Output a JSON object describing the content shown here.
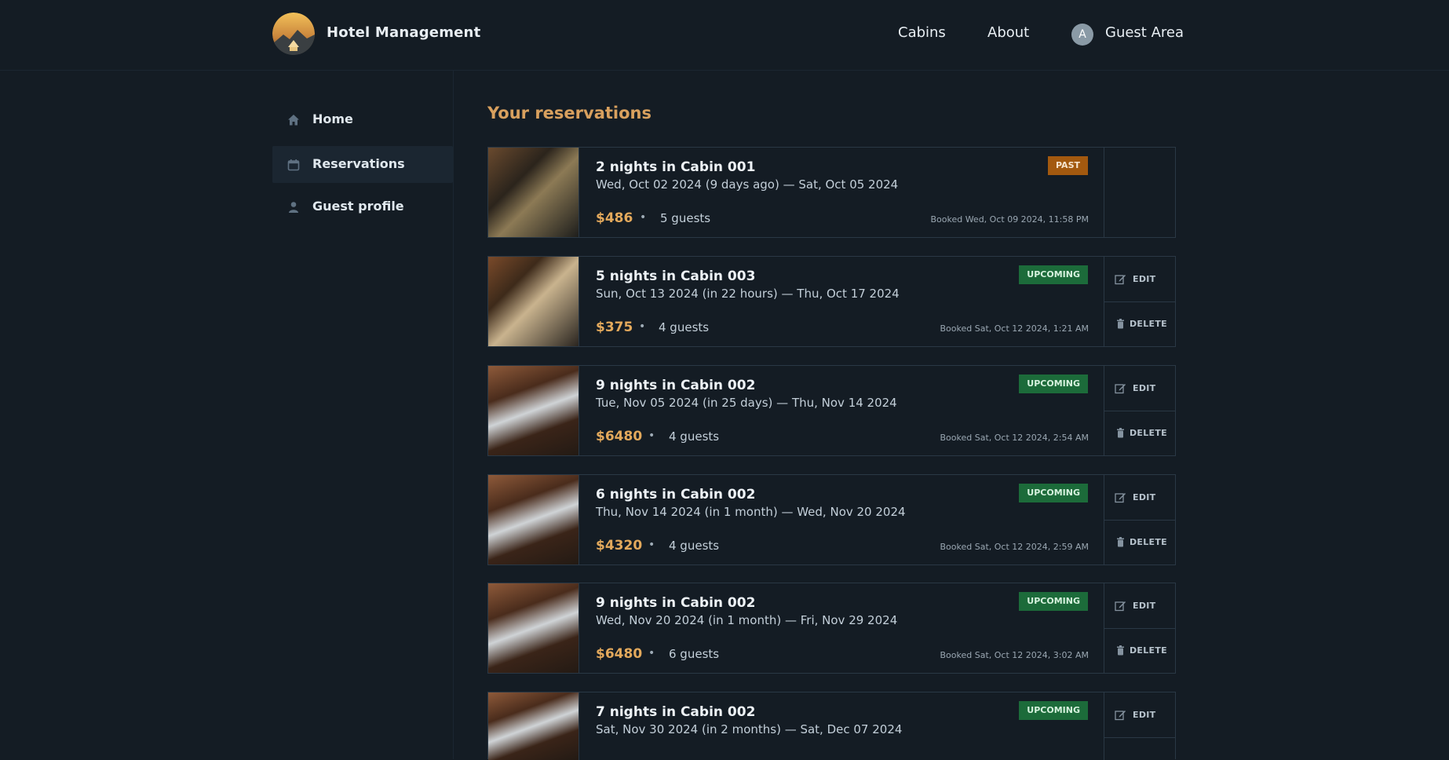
{
  "header": {
    "brand": "Hotel Management",
    "nav": {
      "cabins": "Cabins",
      "about": "About",
      "guest_area": "Guest Area",
      "avatar_initial": "A"
    }
  },
  "sidebar": {
    "items": [
      {
        "label": "Home",
        "icon": "home-icon"
      },
      {
        "label": "Reservations",
        "icon": "calendar-icon"
      },
      {
        "label": "Guest profile",
        "icon": "user-icon"
      }
    ]
  },
  "page": {
    "title": "Your reservations"
  },
  "actions": {
    "edit": "EDIT",
    "delete": "DELETE"
  },
  "colors": {
    "accent": "#d8a05e",
    "past": "#a3590f",
    "upcoming": "#1c6b3a",
    "background": "#141c24"
  },
  "reservations": [
    {
      "title": "2 nights in Cabin 001",
      "dates": "Wed, Oct 02 2024 (9 days ago) — Sat, Oct 05 2024",
      "price": "$486",
      "sep": "•",
      "guests": "5 guests",
      "booked": "Booked Wed, Oct 09 2024, 11:58 PM",
      "status": "PAST"
    },
    {
      "title": "5 nights in Cabin 003",
      "dates": "Sun, Oct 13 2024 (in 22 hours) — Thu, Oct 17 2024",
      "price": "$375",
      "sep": "•",
      "guests": "4 guests",
      "booked": "Booked Sat, Oct 12 2024, 1:21 AM",
      "status": "UPCOMING"
    },
    {
      "title": "9 nights in Cabin 002",
      "dates": "Tue, Nov 05 2024 (in 25 days) — Thu, Nov 14 2024",
      "price": "$6480",
      "sep": "•",
      "guests": "4 guests",
      "booked": "Booked Sat, Oct 12 2024, 2:54 AM",
      "status": "UPCOMING"
    },
    {
      "title": "6 nights in Cabin 002",
      "dates": "Thu, Nov 14 2024 (in 1 month) — Wed, Nov 20 2024",
      "price": "$4320",
      "sep": "•",
      "guests": "4 guests",
      "booked": "Booked Sat, Oct 12 2024, 2:59 AM",
      "status": "UPCOMING"
    },
    {
      "title": "9 nights in Cabin 002",
      "dates": "Wed, Nov 20 2024 (in 1 month) — Fri, Nov 29 2024",
      "price": "$6480",
      "sep": "•",
      "guests": "6 guests",
      "booked": "Booked Sat, Oct 12 2024, 3:02 AM",
      "status": "UPCOMING"
    },
    {
      "title": "7 nights in Cabin 002",
      "dates": "Sat, Nov 30 2024 (in 2 months) — Sat, Dec 07 2024",
      "price": "",
      "sep": "",
      "guests": "",
      "booked": "",
      "status": "UPCOMING"
    }
  ]
}
